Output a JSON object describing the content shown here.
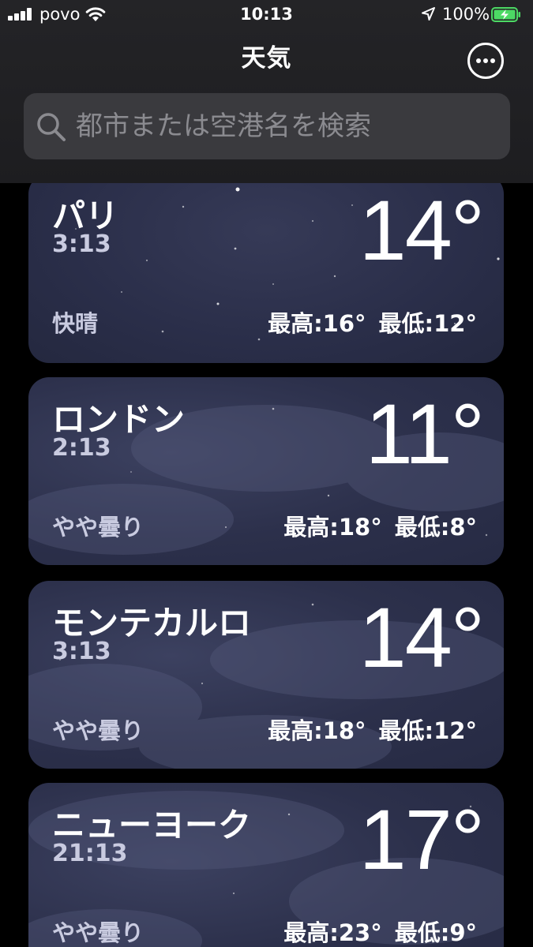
{
  "status_bar": {
    "carrier": "povo",
    "time": "10:13",
    "battery": "100%"
  },
  "header": {
    "title": "天気",
    "more_icon": "ellipsis-circle-icon"
  },
  "search": {
    "placeholder": "都市または空港名を検索",
    "icon": "magnifier-icon"
  },
  "cities": [
    {
      "name": "パリ",
      "time": "3:13",
      "temp": "14°",
      "condition": "快晴",
      "high": "最高:16°",
      "low": "最低:12°"
    },
    {
      "name": "ロンドン",
      "time": "2:13",
      "temp": "11°",
      "condition": "やや曇り",
      "high": "最高:18°",
      "low": "最低:8°"
    },
    {
      "name": "モンテカルロ",
      "time": "3:13",
      "temp": "14°",
      "condition": "やや曇り",
      "high": "最高:18°",
      "low": "最低:12°"
    },
    {
      "name": "ニューヨーク",
      "time": "21:13",
      "temp": "17°",
      "condition": "やや曇り",
      "high": "最高:23°",
      "low": "最低:9°"
    }
  ],
  "colors": {
    "card_background": "#2c304b",
    "header_background": "#242427",
    "search_background": "#3a3a3e",
    "secondary_text": "#c9cbe0",
    "battery_green": "#4cd964"
  }
}
